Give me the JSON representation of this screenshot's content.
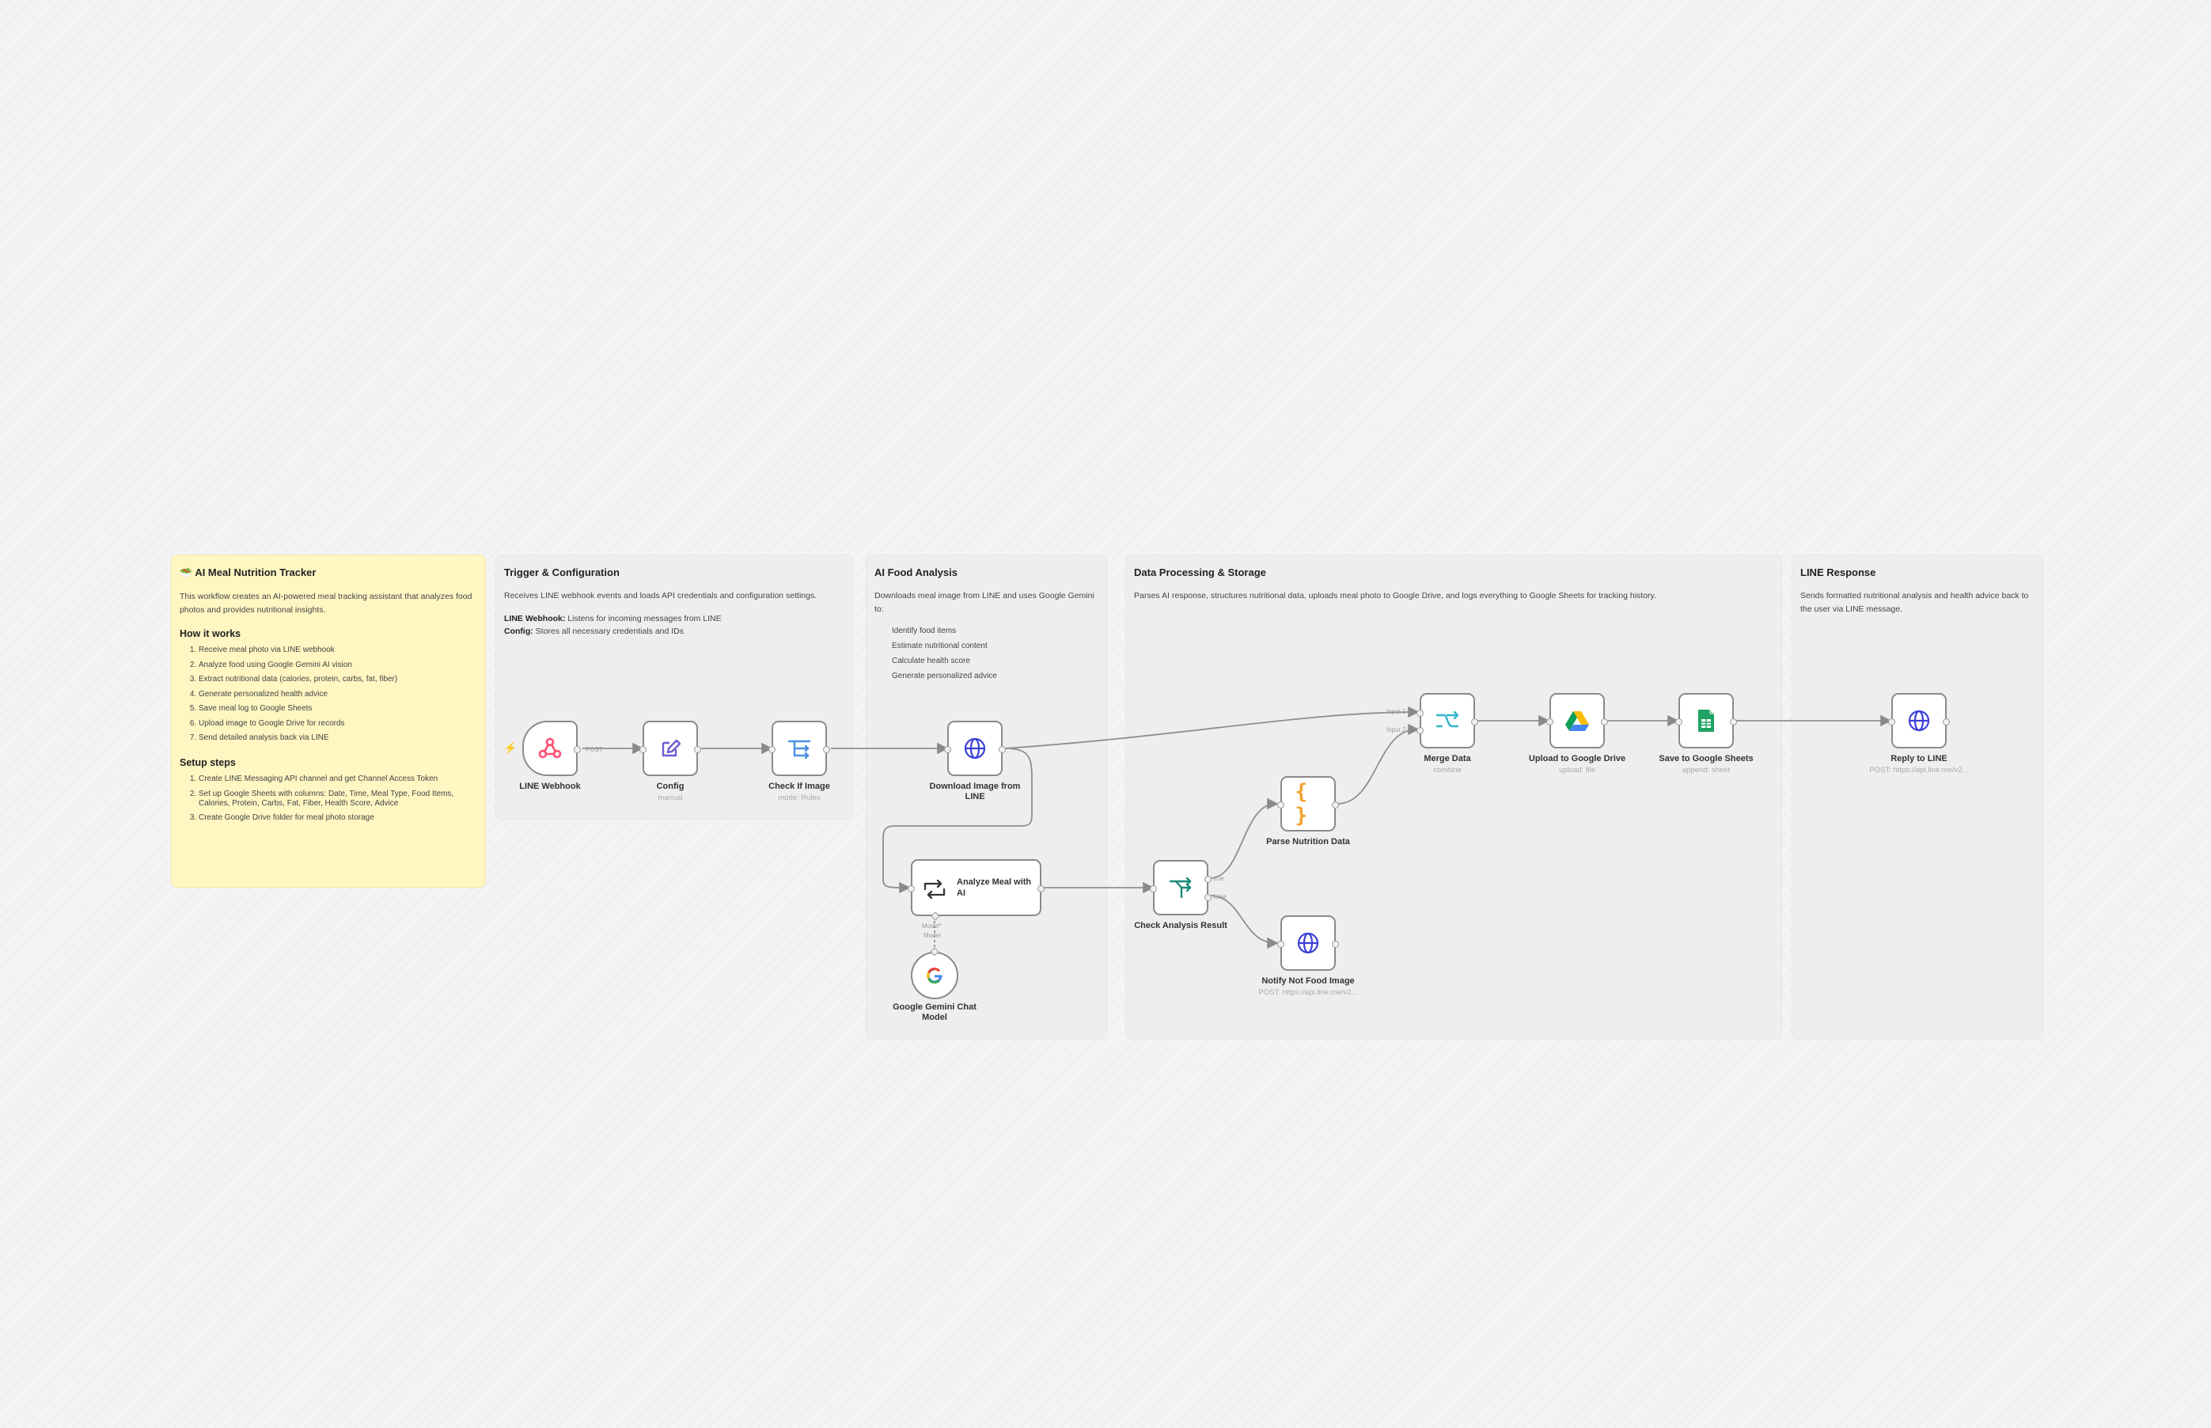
{
  "notes": {
    "main": {
      "title": "🥗 AI Meal Nutrition Tracker",
      "intro": "This workflow creates an AI-powered meal tracking assistant that analyzes food photos and provides nutritional insights.",
      "how_title": "How it works",
      "how": [
        "Receive meal photo via LINE webhook",
        "Analyze food using Google Gemini AI vision",
        "Extract nutritional data (calories, protein, carbs, fat, fiber)",
        "Generate personalized health advice",
        "Save meal log to Google Sheets",
        "Upload image to Google Drive for records",
        "Send detailed analysis back via LINE"
      ],
      "setup_title": "Setup steps",
      "setup": [
        "Create LINE Messaging API channel and get Channel Access Token",
        "Set up Google Sheets with columns: Date, Time, Meal Type, Food Items, Calories, Protein, Carbs, Fat, Fiber, Health Score, Advice",
        "Create Google Drive folder for meal photo storage"
      ]
    },
    "trigger": {
      "title": "Trigger & Configuration",
      "desc": "Receives LINE webhook events and loads API credentials and configuration settings.",
      "k1": "LINE Webhook:",
      "v1": "Listens for incoming messages from LINE",
      "k2": "Config:",
      "v2": "Stores all necessary credentials and IDs"
    },
    "ai": {
      "title": "AI Food Analysis",
      "desc": "Downloads meal image from LINE and uses Google Gemini to:",
      "items": [
        "Identify food items",
        "Estimate nutritional content",
        "Calculate health score",
        "Generate personalized advice"
      ]
    },
    "data": {
      "title": "Data Processing & Storage",
      "desc": "Parses AI response, structures nutritional data, uploads meal photo to Google Drive, and logs everything to Google Sheets for tracking history."
    },
    "line": {
      "title": "LINE Response",
      "desc": "Sends formatted nutritional analysis and health advice back to the user via LINE message."
    }
  },
  "nodes": {
    "webhook": {
      "label": "LINE Webhook",
      "icon": "webhook-icon"
    },
    "config": {
      "label": "Config",
      "sub": "manual",
      "icon": "pencil-icon"
    },
    "check_image": {
      "label": "Check If Image",
      "sub": "mode: Rules",
      "icon": "switch-icon"
    },
    "download": {
      "label": "Download Image from LINE",
      "icon": "globe-icon"
    },
    "analyze": {
      "label": "Analyze Meal with AI",
      "icon": "llm-chain-icon"
    },
    "gemini": {
      "label": "Google Gemini Chat Model",
      "icon": "google-icon"
    },
    "check_result": {
      "label": "Check Analysis Result",
      "icon": "if-icon"
    },
    "parse": {
      "label": "Parse Nutrition Data",
      "icon": "braces-icon"
    },
    "notify": {
      "label": "Notify Not Food Image",
      "sub": "POST: https://api.line.me/v2...",
      "icon": "globe-icon"
    },
    "merge": {
      "label": "Merge Data",
      "sub": "combine",
      "icon": "merge-icon"
    },
    "drive": {
      "label": "Upload to Google Drive",
      "sub": "upload: file",
      "icon": "google-drive-icon"
    },
    "sheets": {
      "label": "Save to Google Sheets",
      "sub": "append: sheet",
      "icon": "google-sheets-icon"
    },
    "reply": {
      "label": "Reply to LINE",
      "sub": "POST: https://api.line.me/v2...",
      "icon": "globe-icon"
    }
  },
  "edge_labels": {
    "post": "POST",
    "model": "Model*",
    "model2": "Model",
    "true": "true",
    "false": "false",
    "input1": "Input 1",
    "input2": "Input 2"
  },
  "colors": {
    "sticky_main": "#fff6c2",
    "sticky_section": "#eeeeee",
    "webhook": "#ff4f73",
    "pencil": "#6d5bd0",
    "switch": "#4a90e2",
    "globe": "#3b3fd8",
    "if": "#1a8a7a",
    "braces": "#f2a12c",
    "merge": "#2fb3c9",
    "sheets": "#1ea362"
  }
}
